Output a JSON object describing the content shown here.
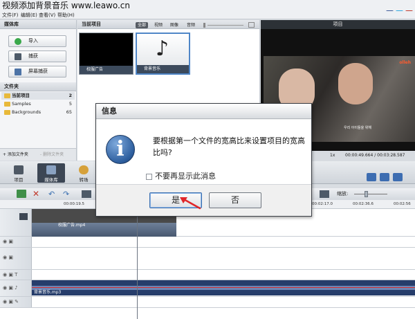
{
  "window": {
    "title": "视频添加背景音乐 www.leawo.cn"
  },
  "menu": [
    "文件(F)",
    "编辑(E)",
    "查看(V)",
    "帮助(H)"
  ],
  "social": {
    "facebook": "f",
    "twitter": "t",
    "other": "g"
  },
  "sidebar": {
    "header": "媒体库",
    "buttons": [
      "导入",
      "捕获",
      "屏幕捕获"
    ],
    "folders_header": "文件夹",
    "folders": [
      {
        "name": "当前项目",
        "count": "2"
      },
      {
        "name": "Samples",
        "count": "5"
      },
      {
        "name": "Backgrounds",
        "count": "65"
      }
    ],
    "add_folder": "+ 添加文件夹",
    "delete_folder": "- 删除文件夹"
  },
  "media": {
    "header": "当前项目",
    "filters": [
      "全部",
      "视频",
      "图像",
      "音频"
    ],
    "items": [
      "校服广告",
      "背景音乐"
    ]
  },
  "preview": {
    "header": "项目",
    "subtitle": "우리 아이들을 위해",
    "logo": "olleh",
    "speed": "1x",
    "time": "00:00:49.664 / 00:03:28.587"
  },
  "modes": [
    "项目",
    "媒体库",
    "转场"
  ],
  "timeline": {
    "zoom_label": "缩放:",
    "ruler": [
      "00:00:19.5",
      "00:02:17.0",
      "00:02:36.6",
      "00:02:56"
    ],
    "video_clip": "校服广告.mp4",
    "audio_clip": "背景音乐.mp3"
  },
  "dialog": {
    "title": "信息",
    "message": "要根据第一个文件的宽高比来设置项目的宽高比吗?",
    "checkbox": "不要再显示此消息",
    "yes": "是",
    "no": "否"
  },
  "colors": {
    "accent": "#3a6fb0",
    "audio_track": "#263d6b",
    "red_arrow": "#e0262a"
  }
}
